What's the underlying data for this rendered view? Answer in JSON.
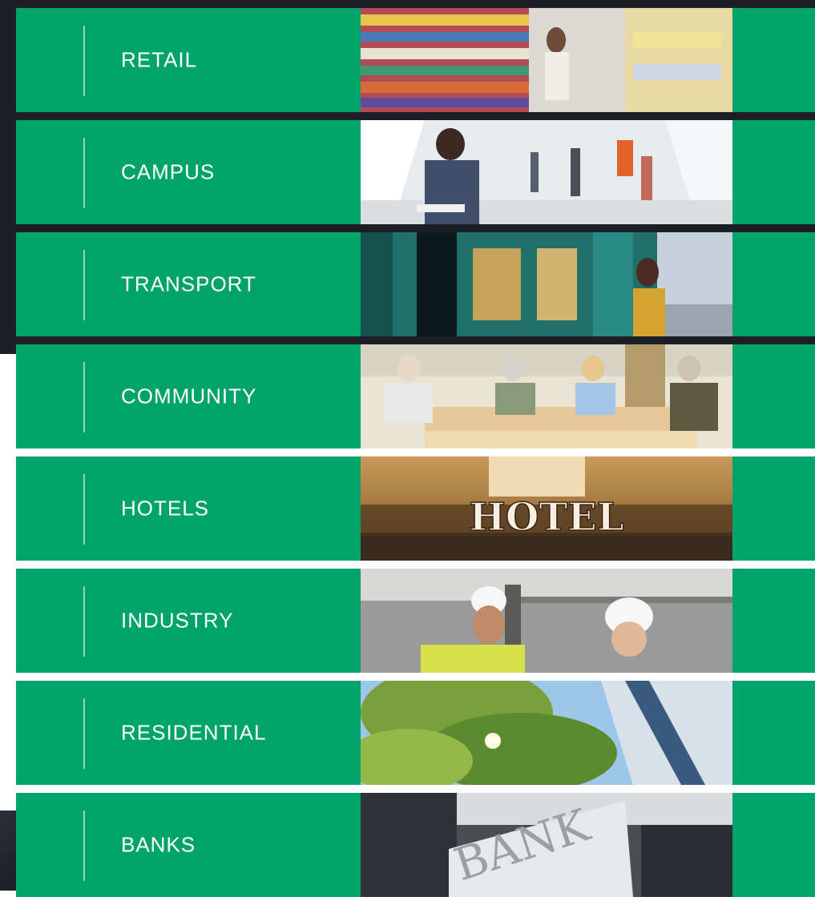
{
  "sectors": [
    {
      "label": "RETAIL",
      "icon": "retail-photo"
    },
    {
      "label": "CAMPUS",
      "icon": "campus-photo"
    },
    {
      "label": "TRANSPORT",
      "icon": "transport-photo"
    },
    {
      "label": "COMMUNITY",
      "icon": "community-photo"
    },
    {
      "label": "HOTELS",
      "icon": "hotels-photo",
      "photo_text": "HOTEL"
    },
    {
      "label": "INDUSTRY",
      "icon": "industry-photo"
    },
    {
      "label": "RESIDENTIAL",
      "icon": "residential-photo"
    },
    {
      "label": "BANKS",
      "icon": "banks-photo",
      "photo_text": "BANK"
    }
  ],
  "colors": {
    "accent": "#00a46a",
    "dark_background": "#1c1f26",
    "text": "#ffffff"
  }
}
